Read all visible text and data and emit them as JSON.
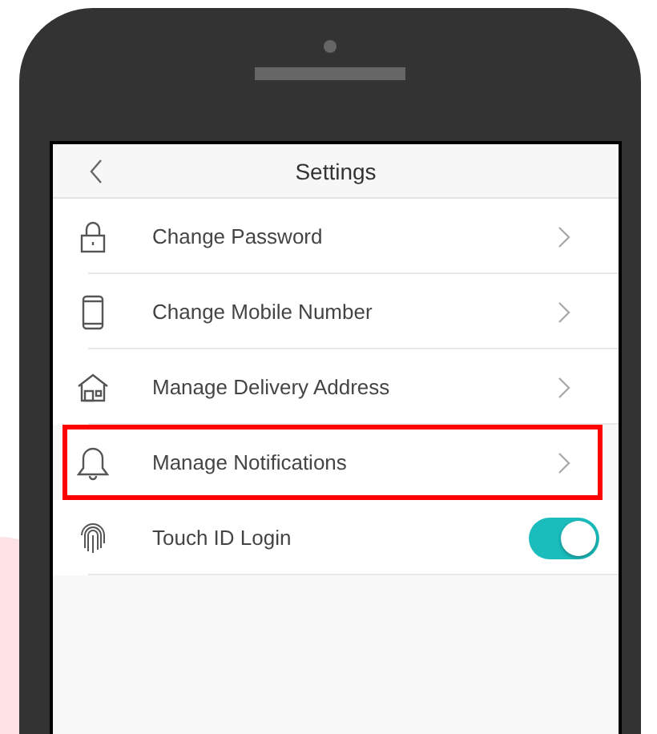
{
  "header": {
    "title": "Settings"
  },
  "items": [
    {
      "kind": "link",
      "label": "Change Password",
      "highlighted": false
    },
    {
      "kind": "link",
      "label": "Change Mobile Number",
      "highlighted": false
    },
    {
      "kind": "link",
      "label": "Manage Delivery Address",
      "highlighted": false
    },
    {
      "kind": "link",
      "label": "Manage Notifications",
      "highlighted": true
    },
    {
      "kind": "toggle",
      "label": "Touch ID Login",
      "on": true
    }
  ]
}
